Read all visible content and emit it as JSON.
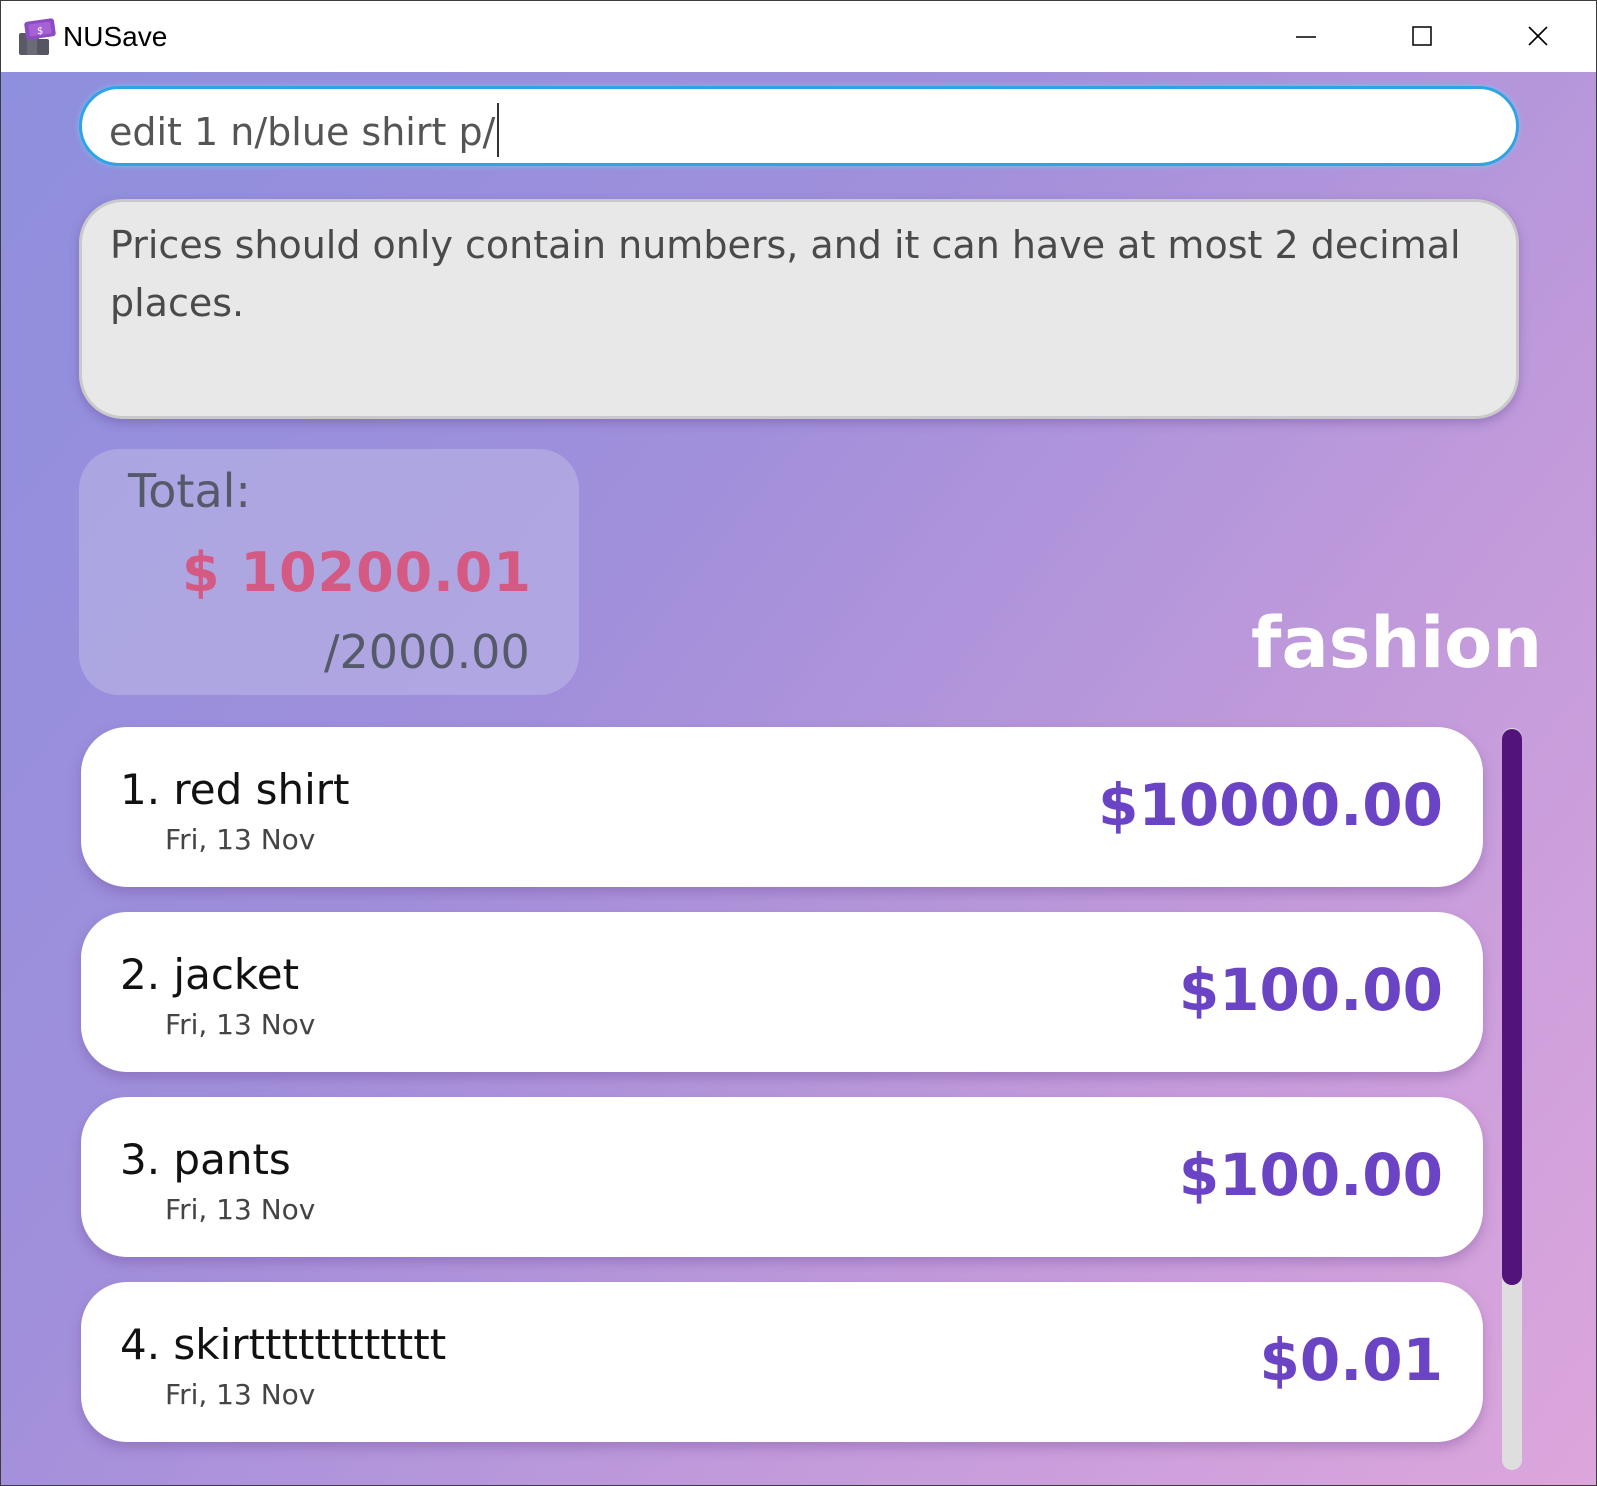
{
  "window": {
    "title": "NUSave",
    "icon": "nusave-app-icon",
    "controls": [
      "minimize-icon",
      "maximize-icon",
      "close-icon"
    ]
  },
  "command": {
    "value": "edit 1 n/blue shirt p/"
  },
  "result": {
    "message": "Prices should only contain numbers, and it can have at most 2 decimal places."
  },
  "total": {
    "label": "Total:",
    "amount": "$ 10200.01",
    "budget": "/2000.00"
  },
  "category": {
    "title": "fashion"
  },
  "expenses": [
    {
      "name": "1. red shirt",
      "date": "Fri, 13 Nov",
      "price": "$10000.00"
    },
    {
      "name": "2. jacket",
      "date": "Fri, 13 Nov",
      "price": "$100.00"
    },
    {
      "name": "3. pants",
      "date": "Fri, 13 Nov",
      "price": "$100.00"
    },
    {
      "name": "4. skirtttttttttttt",
      "date": "Fri, 13 Nov",
      "price": "$0.01"
    }
  ],
  "colors": {
    "accent": "#6a44c4",
    "over_budget": "#d45a84",
    "input_border": "#2ea3e6",
    "scroll_thumb": "#52137a"
  }
}
